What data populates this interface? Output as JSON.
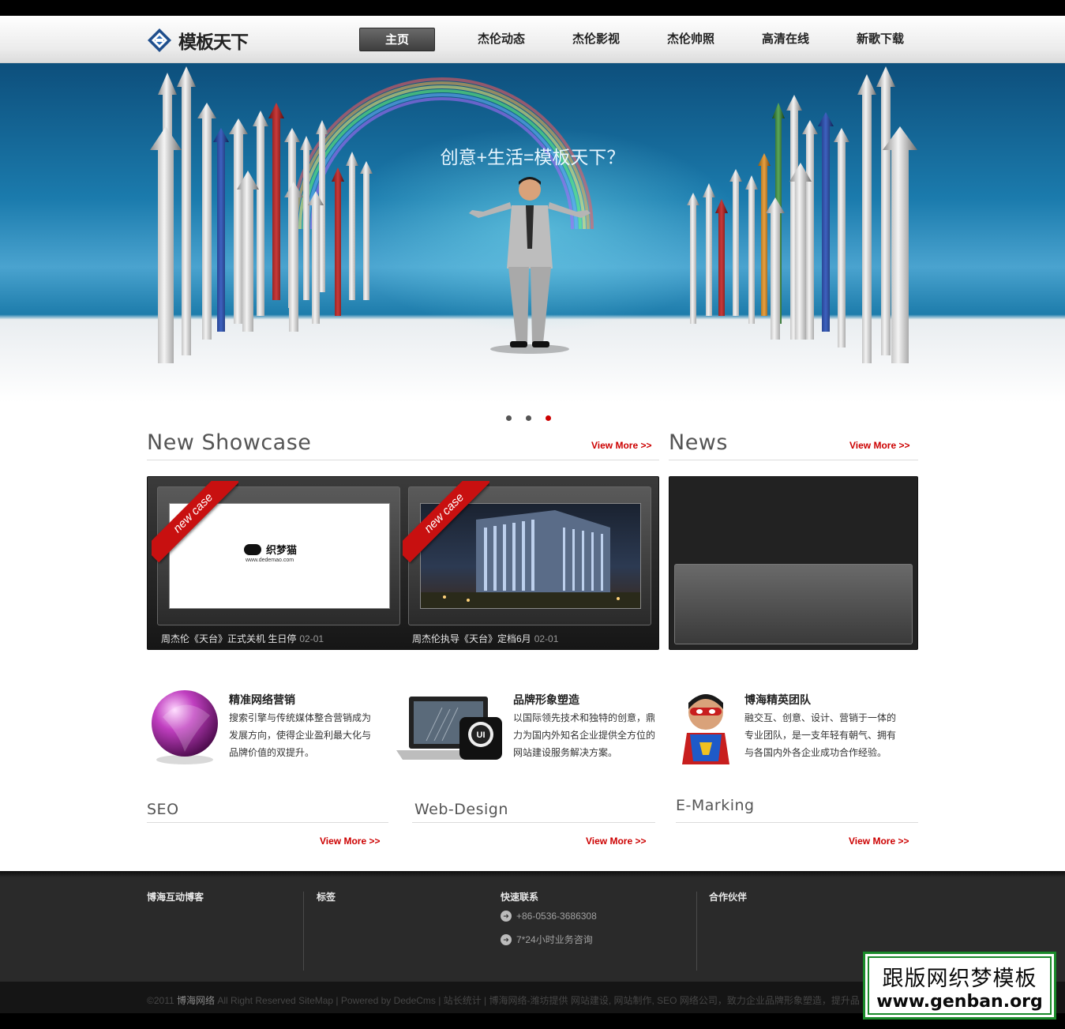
{
  "header": {
    "logo_text": "模板天下",
    "nav": [
      {
        "label": "主页",
        "active": true
      },
      {
        "label": "杰伦动态",
        "active": false
      },
      {
        "label": "杰伦影视",
        "active": false
      },
      {
        "label": "杰伦帅照",
        "active": false
      },
      {
        "label": "高清在线",
        "active": false
      },
      {
        "label": "新歌下载",
        "active": false
      }
    ]
  },
  "banner": {
    "slogan": "创意+生活=模板天下？",
    "dots": 3,
    "active_dot": 3
  },
  "showcase": {
    "title": "New Showcase",
    "more": "View More >>",
    "badge": "new case",
    "items": [
      {
        "caption": "周杰伦《天台》正式关机 生日停",
        "date": "02-01",
        "thumb_text": "织梦猫",
        "thumb_url": "www.dedemao.com"
      },
      {
        "caption": "周杰伦执导《天台》定档6月",
        "date": "02-01"
      }
    ]
  },
  "news": {
    "title": "News",
    "more": "View More >>"
  },
  "services": [
    {
      "title": "精准网络营销",
      "desc": "搜索引擎与传统媒体整合营销成为发展方向，使得企业盈利最大化与品牌价值的双提升。",
      "heading": "SEO",
      "more": "View More >>",
      "icon": "purple-sphere-icon"
    },
    {
      "title": "品牌形象塑造",
      "desc": "以国际领先技术和独特的创意，鼎力为国内外知名企业提供全方位的网站建设服务解决方案。",
      "heading": "Web-Design",
      "more": "View More >>",
      "icon": "laptop-ui-icon"
    },
    {
      "title": "博海精英团队",
      "desc": "融交互、创意、设计、营销于一体的专业团队，是一支年轻有朝气、拥有与各国内外各企业成功合作经验。",
      "heading": "E-Marking",
      "more": "View More >>",
      "icon": "superhero-icon"
    }
  ],
  "footer": {
    "columns": [
      "博海互动博客",
      "标签",
      "快速联系",
      "合作伙伴"
    ],
    "phone": "+86-0536-3686308",
    "service": "7*24小时业务咨询",
    "copyright_prefix": "©2011",
    "company": "博海网络",
    "copyright_rest": "All Right Reserved SiteMap | Powered by DedeCms | 站长统计 | 博海网络-潍坊提供 网站建设, 网站制作, SEO 网络公司，致力企业品牌形象塑造，提升品"
  },
  "watermark": {
    "line1": "跟版网织梦模板",
    "line2": "www.genban.org"
  },
  "colors": {
    "accent_red": "#cc0000",
    "footer_bg": "#2a2a2a",
    "banner_blue": "#1b7bad"
  }
}
